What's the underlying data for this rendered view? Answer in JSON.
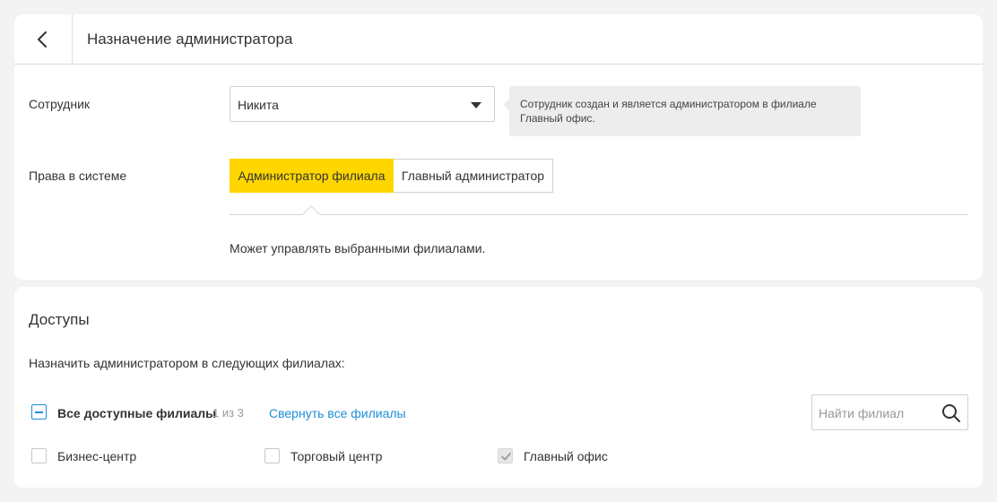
{
  "header": {
    "title": "Назначение администратора",
    "back_icon": "chevron-left-icon"
  },
  "employee": {
    "label": "Сотрудник",
    "selected": "Никита",
    "info": "Сотрудник создан и является администратором в филиале Главный офис."
  },
  "rights": {
    "label": "Права в системе",
    "options": [
      "Администратор филиала",
      "Главный администратор"
    ],
    "active_index": 0,
    "description": "Может управлять выбранными филиалами."
  },
  "access": {
    "title": "Доступы",
    "assign_text": "Назначить администратором в следующих филиалах:",
    "all_label": "Все доступные филиалы",
    "count": "1 из 3",
    "collapse_link": "Свернуть все филиалы",
    "search_placeholder": "Найти филиал",
    "branches": [
      {
        "label": "Бизнес-центр",
        "checked": false,
        "disabled": false
      },
      {
        "label": "Торговый центр",
        "checked": false,
        "disabled": false
      },
      {
        "label": "Главный офис",
        "checked": true,
        "disabled": true
      }
    ]
  },
  "colors": {
    "accent_yellow": "#ffd600",
    "link_blue": "#1b8fd6",
    "background": "#f2f3f2"
  }
}
